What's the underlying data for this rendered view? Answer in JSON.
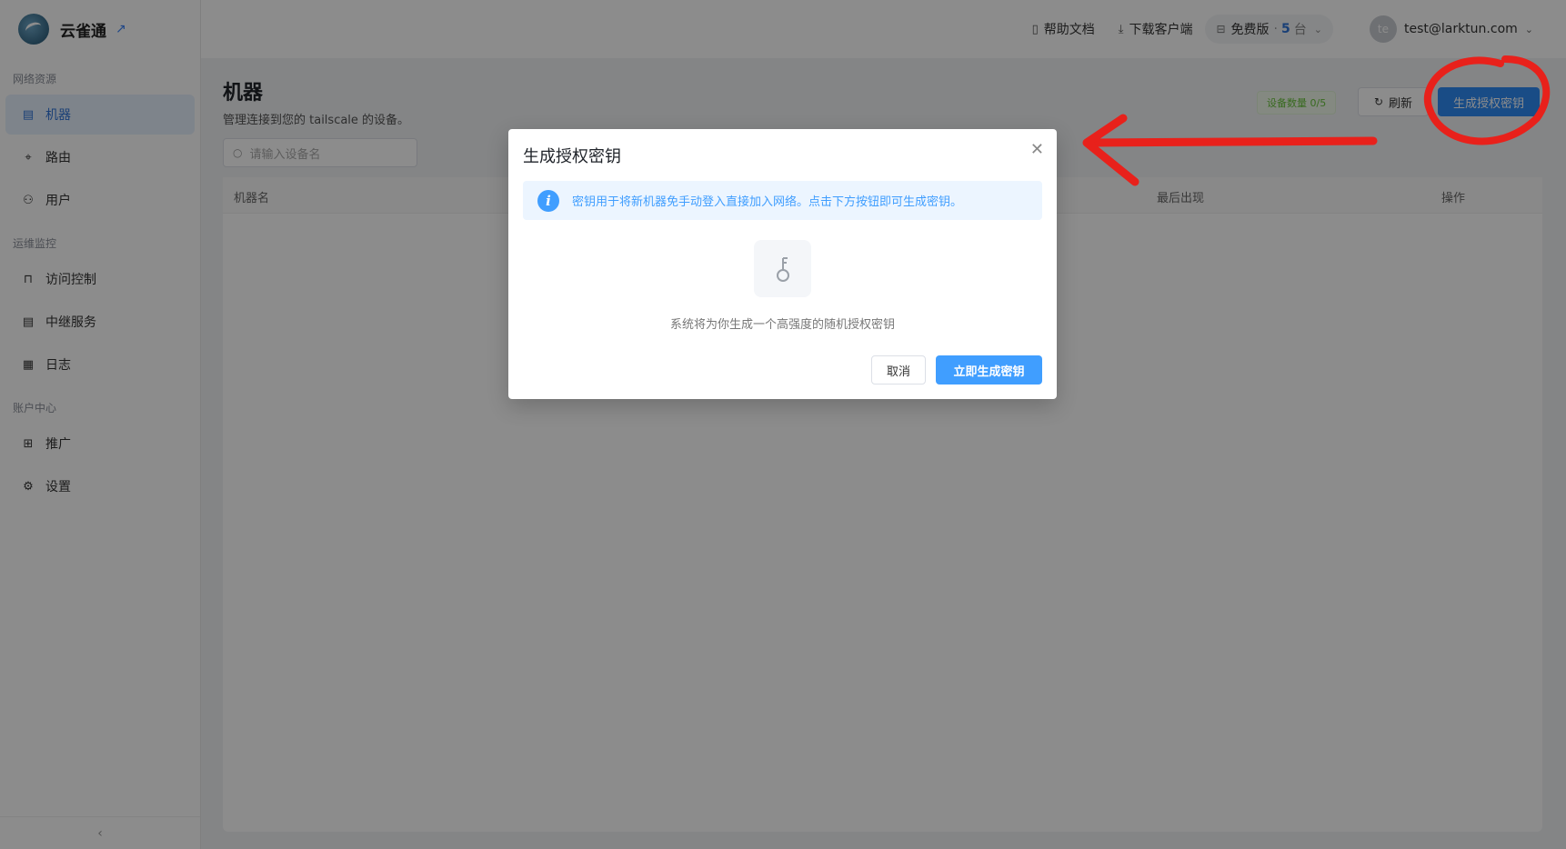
{
  "brand": {
    "name": "云雀通",
    "ext_icon": "external-link-icon"
  },
  "sidebar": {
    "groups": [
      {
        "label": "网络资源",
        "items": [
          {
            "label": "机器",
            "icon": "server-icon",
            "active": true
          },
          {
            "label": "路由",
            "icon": "route-icon"
          },
          {
            "label": "用户",
            "icon": "users-icon"
          }
        ]
      },
      {
        "label": "运维监控",
        "items": [
          {
            "label": "访问控制",
            "icon": "lock-icon"
          },
          {
            "label": "中继服务",
            "icon": "relay-icon"
          },
          {
            "label": "日志",
            "icon": "log-icon"
          }
        ]
      },
      {
        "label": "账户中心",
        "items": [
          {
            "label": "推广",
            "icon": "promo-icon"
          },
          {
            "label": "设置",
            "icon": "gear-icon"
          }
        ]
      }
    ],
    "collapse_glyph": "‹"
  },
  "header": {
    "docs": "帮助文档",
    "download": "下载客户端",
    "plan": {
      "name": "免费版",
      "sep": "·",
      "count": "5",
      "unit": "台"
    },
    "avatar_initials": "te",
    "user_email": "test@larktun.com"
  },
  "main": {
    "title": "机器",
    "description": "管理连接到您的 tailscale 的设备。",
    "search_placeholder": "请输入设备名",
    "device_count": "设备数量 0/5",
    "refresh_label": "刷新",
    "genkey_label": "生成授权密钥",
    "columns": [
      "机器名",
      "最后出现",
      "操作"
    ]
  },
  "dialog": {
    "title": "生成授权密钥",
    "alert_glyph": "i",
    "alert_text": "密钥用于将新机器免手动登入直接加入网络。点击下方按钮即可生成密钥。",
    "description": "系统将为你生成一个高强度的随机授权密钥",
    "cancel_label": "取消",
    "confirm_label": "立即生成密钥"
  },
  "colors": {
    "primary": "#409eff",
    "annotation": "#e8211b"
  }
}
